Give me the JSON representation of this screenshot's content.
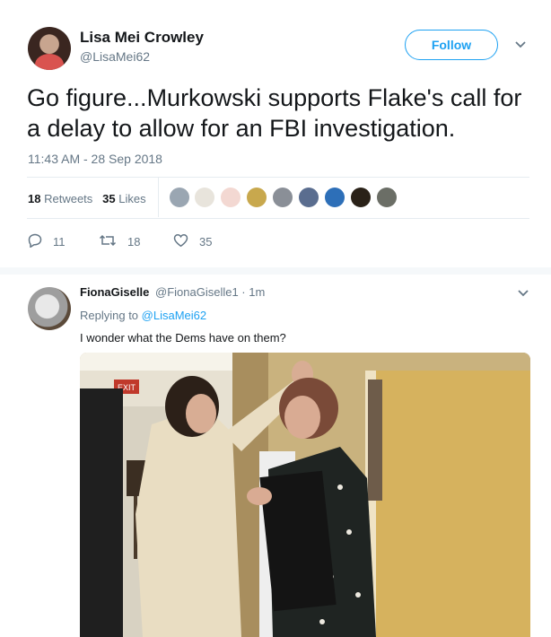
{
  "main_tweet": {
    "display_name": "Lisa Mei Crowley",
    "handle": "@LisaMei62",
    "follow_label": "Follow",
    "text": "Go figure...Murkowski supports Flake's call for a delay to allow for an FBI investigation.",
    "timestamp": "11:43 AM - 28 Sep 2018",
    "retweets_count": "18",
    "retweets_label": "Retweets",
    "likes_count": "35",
    "likes_label": "Likes",
    "actions": {
      "reply_count": "11",
      "retweet_count": "18",
      "like_count": "35"
    }
  },
  "reply": {
    "display_name": "FionaGiselle",
    "meta": "@FionaGiselle1 · 1m",
    "replying_prefix": "Replying to",
    "replying_to": "@LisaMei62",
    "text": "I wonder what the Dems have on them?"
  },
  "photo_sign_text": "EXIT",
  "colors": {
    "accent": "#1da1f2",
    "secondary_text": "#657786",
    "primary_text": "#14171a",
    "divider": "#e6ecf0",
    "like": "#e0245e"
  },
  "icons": [
    "chevron-down-icon",
    "reply-icon",
    "retweet-icon",
    "heart-icon"
  ]
}
